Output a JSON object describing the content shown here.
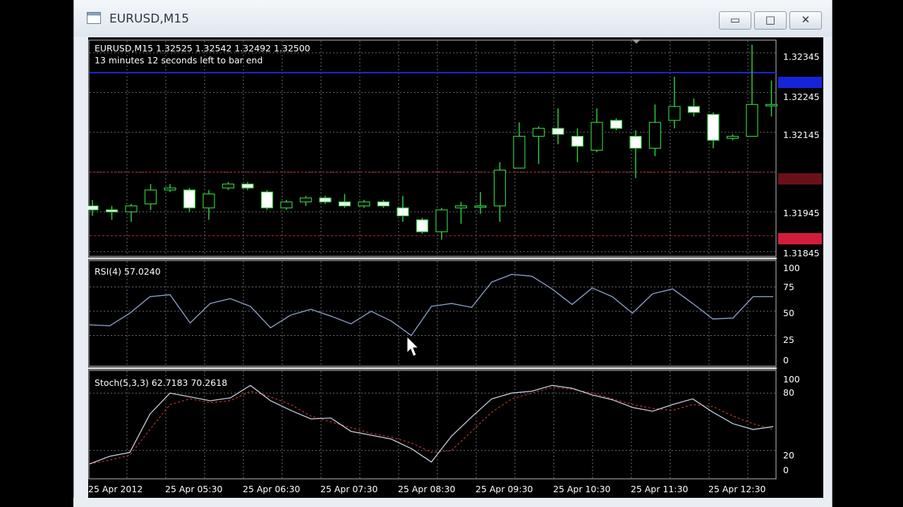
{
  "window": {
    "title": "EURUSD,M15",
    "buttons": {
      "minimize": "▭",
      "maximize": "□",
      "close": "✕"
    }
  },
  "price_panel": {
    "header": "EURUSD,M15  1.32525 1.32542 1.32492 1.32500",
    "countdown": "13 minutes 12 seconds left to bar end",
    "price_labels": [
      "1.32345",
      "1.32245",
      "1.32145",
      "1.31945",
      "1.31845"
    ],
    "colors": {
      "bull_border": "#2ecc40",
      "bull_body": "#000000",
      "bear_body": "#ffffff",
      "wick": "#2ecc40",
      "grid": "#6f6f6f",
      "blue_line": "#1a2cd6",
      "red_line": "#c22333"
    }
  },
  "rsi_panel": {
    "label": "RSI(4) 57.0240",
    "levels": [
      "100",
      "75",
      "50",
      "25",
      "0"
    ]
  },
  "stoch_panel": {
    "label": "Stoch(5,3,3) 62.7183 70.2618",
    "levels": [
      "100",
      "80",
      "20",
      "0"
    ]
  },
  "time_labels": [
    "25 Apr 2012",
    "25 Apr 05:30",
    "25 Apr 06:30",
    "25 Apr 07:30",
    "25 Apr 08:30",
    "25 Apr 09:30",
    "25 Apr 10:30",
    "25 Apr 11:30",
    "25 Apr 12:30"
  ],
  "chart_data": [
    {
      "type": "candlestick",
      "title": "EURUSD,M15",
      "ylim": [
        1.3183,
        1.3237
      ],
      "candles": [
        {
          "o": 1.31955,
          "h": 1.3197,
          "l": 1.3193,
          "c": 1.31945
        },
        {
          "o": 1.31945,
          "h": 1.31955,
          "l": 1.3192,
          "c": 1.3194
        },
        {
          "o": 1.3194,
          "h": 1.3196,
          "l": 1.31915,
          "c": 1.31955
        },
        {
          "o": 1.3196,
          "h": 1.3201,
          "l": 1.31945,
          "c": 1.31995
        },
        {
          "o": 1.31995,
          "h": 1.3201,
          "l": 1.3199,
          "c": 1.32
        },
        {
          "o": 1.31995,
          "h": 1.32,
          "l": 1.3194,
          "c": 1.3195
        },
        {
          "o": 1.3195,
          "h": 1.31995,
          "l": 1.3192,
          "c": 1.31985
        },
        {
          "o": 1.32,
          "h": 1.32015,
          "l": 1.31995,
          "c": 1.3201
        },
        {
          "o": 1.3201,
          "h": 1.32015,
          "l": 1.31995,
          "c": 1.32
        },
        {
          "o": 1.3199,
          "h": 1.31995,
          "l": 1.31945,
          "c": 1.3195
        },
        {
          "o": 1.3195,
          "h": 1.3197,
          "l": 1.31945,
          "c": 1.31965
        },
        {
          "o": 1.31965,
          "h": 1.3198,
          "l": 1.31955,
          "c": 1.31975
        },
        {
          "o": 1.31975,
          "h": 1.3198,
          "l": 1.3196,
          "c": 1.31965
        },
        {
          "o": 1.31965,
          "h": 1.31985,
          "l": 1.3195,
          "c": 1.31955
        },
        {
          "o": 1.31955,
          "h": 1.3197,
          "l": 1.3195,
          "c": 1.31965
        },
        {
          "o": 1.31965,
          "h": 1.3197,
          "l": 1.3195,
          "c": 1.31955
        },
        {
          "o": 1.3195,
          "h": 1.3198,
          "l": 1.31915,
          "c": 1.3193
        },
        {
          "o": 1.3192,
          "h": 1.31925,
          "l": 1.31885,
          "c": 1.3189
        },
        {
          "o": 1.3189,
          "h": 1.3195,
          "l": 1.3187,
          "c": 1.31945
        },
        {
          "o": 1.3195,
          "h": 1.31965,
          "l": 1.3191,
          "c": 1.31955
        },
        {
          "o": 1.31955,
          "h": 1.3199,
          "l": 1.31935,
          "c": 1.31955
        },
        {
          "o": 1.31955,
          "h": 1.32065,
          "l": 1.31915,
          "c": 1.32045
        },
        {
          "o": 1.3205,
          "h": 1.32165,
          "l": 1.3205,
          "c": 1.3213
        },
        {
          "o": 1.3213,
          "h": 1.32155,
          "l": 1.3206,
          "c": 1.3215
        },
        {
          "o": 1.3215,
          "h": 1.322,
          "l": 1.3211,
          "c": 1.32135
        },
        {
          "o": 1.3213,
          "h": 1.3215,
          "l": 1.32065,
          "c": 1.32105
        },
        {
          "o": 1.32095,
          "h": 1.322,
          "l": 1.3209,
          "c": 1.32165
        },
        {
          "o": 1.3217,
          "h": 1.32175,
          "l": 1.32145,
          "c": 1.3215
        },
        {
          "o": 1.3213,
          "h": 1.32145,
          "l": 1.32025,
          "c": 1.321
        },
        {
          "o": 1.321,
          "h": 1.3221,
          "l": 1.3208,
          "c": 1.32165
        },
        {
          "o": 1.3217,
          "h": 1.3228,
          "l": 1.3215,
          "c": 1.32205
        },
        {
          "o": 1.32205,
          "h": 1.32225,
          "l": 1.3218,
          "c": 1.3219
        },
        {
          "o": 1.32185,
          "h": 1.3219,
          "l": 1.321,
          "c": 1.3212
        },
        {
          "o": 1.32125,
          "h": 1.32135,
          "l": 1.3212,
          "c": 1.3213
        },
        {
          "o": 1.3213,
          "h": 1.3236,
          "l": 1.3213,
          "c": 1.3221
        },
        {
          "o": 1.3221,
          "h": 1.3227,
          "l": 1.3218,
          "c": 1.3221
        }
      ],
      "horizontal_lines": [
        {
          "name": "blue",
          "value": 1.3229
        },
        {
          "name": "red-upper",
          "value": 1.3204
        },
        {
          "name": "red-lower",
          "value": 1.3188
        }
      ]
    },
    {
      "type": "line",
      "title": "RSI(4) 57.0240",
      "ylim": [
        0,
        100
      ],
      "series": [
        {
          "values": [
            36,
            35,
            48,
            65,
            67,
            38,
            58,
            63,
            55,
            33,
            46,
            52,
            45,
            37,
            50,
            40,
            25,
            55,
            58,
            54,
            80,
            88,
            86,
            73,
            57,
            74,
            65,
            48,
            68,
            73,
            58,
            42,
            43,
            65,
            65
          ]
        }
      ]
    },
    {
      "type": "line",
      "title": "Stoch(5,3,3) 62.7183 70.2618",
      "ylim": [
        0,
        100
      ],
      "series": [
        {
          "values": [
            6,
            14,
            18,
            58,
            80,
            76,
            72,
            75,
            88,
            72,
            62,
            53,
            54,
            40,
            36,
            32,
            22,
            8,
            35,
            55,
            74,
            80,
            82,
            88,
            85,
            78,
            73,
            65,
            61,
            68,
            74,
            60,
            48,
            42,
            45
          ]
        },
        {
          "values": [
            6,
            10,
            15,
            42,
            68,
            74,
            70,
            72,
            82,
            76,
            68,
            56,
            50,
            44,
            38,
            34,
            28,
            18,
            20,
            40,
            60,
            74,
            80,
            86,
            84,
            80,
            74,
            68,
            64,
            62,
            68,
            66,
            56,
            48,
            42
          ]
        }
      ]
    }
  ]
}
